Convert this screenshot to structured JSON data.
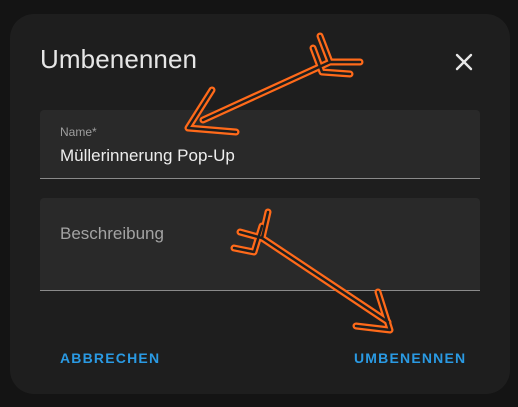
{
  "dialog": {
    "title": "Umbenennen",
    "close_icon": "close-icon"
  },
  "name_field": {
    "label": "Name*",
    "value": "Müllerinnerung Pop-Up"
  },
  "description_field": {
    "label": "Beschreibung",
    "value": ""
  },
  "actions": {
    "cancel_label": "ABBRECHEN",
    "confirm_label": "UMBENENNEN"
  },
  "annotations": {
    "icons": [
      "arrow-annotation-icon",
      "arrow-annotation-icon"
    ],
    "color": "#ff6a1a"
  },
  "colors": {
    "background": "#141414",
    "dialog": "#1e1e1e",
    "field": "#292929",
    "accent": "#2a9ae3"
  }
}
